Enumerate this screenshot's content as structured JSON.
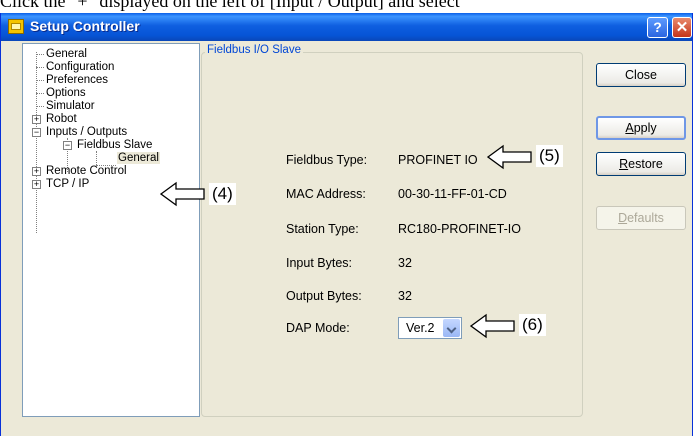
{
  "caption": "Click the \"+\" displayed on the left of [Input / Output] and select",
  "window": {
    "title": "Setup Controller",
    "help_label": "?",
    "close_label": "✕"
  },
  "tree": {
    "general": "General",
    "configuration": "Configuration",
    "preferences": "Preferences",
    "options": "Options",
    "simulator": "Simulator",
    "robot": "Robot",
    "inputs_outputs": "Inputs / Outputs",
    "fieldbus_slave": "Fieldbus Slave",
    "fieldbus_general": "General",
    "remote_control": "Remote Control",
    "tcp_ip": "TCP / IP",
    "expand_plus": "+",
    "expand_minus": "−"
  },
  "panel": {
    "group_title": "Fieldbus I/O Slave",
    "fields": [
      {
        "label": "Fieldbus Type:",
        "value": "PROFINET IO"
      },
      {
        "label": "MAC Address:",
        "value": "00-30-11-FF-01-CD"
      },
      {
        "label": "Station Type:",
        "value": "RC180-PROFINET-IO"
      },
      {
        "label": "Input Bytes:",
        "value": "32"
      },
      {
        "label": "Output Bytes:",
        "value": "32"
      }
    ],
    "dap_label": "DAP Mode:",
    "dap_value": "Ver.2"
  },
  "buttons": {
    "close": "Close",
    "apply_first": "A",
    "apply_rest": "pply",
    "restore_first": "R",
    "restore_rest": "estore",
    "defaults_first": "D",
    "defaults_rest": "efaults"
  },
  "callouts": {
    "c4": "(4)",
    "c5": "(5)",
    "c6": "(6)"
  }
}
